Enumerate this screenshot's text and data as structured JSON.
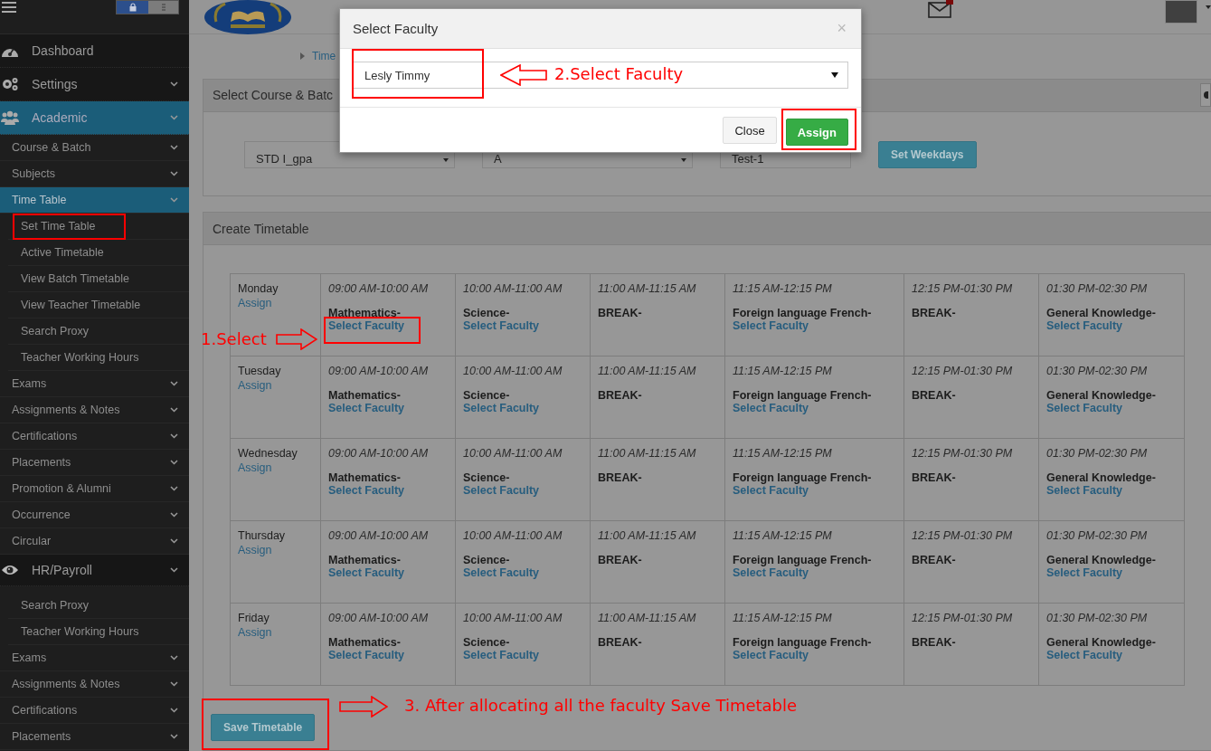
{
  "sidebar": {
    "items": [
      {
        "label": "Dashboard",
        "kind": "link",
        "selected": false
      },
      {
        "label": "Settings",
        "kind": "menu",
        "selected": false
      },
      {
        "label": "Academic",
        "kind": "menu",
        "selected": true,
        "children": [
          {
            "label": "Course & Batch",
            "kind": "menu",
            "selected": false
          },
          {
            "label": "Subjects",
            "kind": "menu",
            "selected": false
          },
          {
            "label": "Time Table",
            "kind": "menu",
            "selected": true,
            "children": [
              {
                "label": "Set Time Table",
                "kind": "link",
                "selected": false,
                "marked": true
              },
              {
                "label": "Active Timetable",
                "kind": "link",
                "selected": false,
                "marked": false
              },
              {
                "label": "View Batch Timetable",
                "kind": "link",
                "selected": false,
                "marked": false
              },
              {
                "label": "View Teacher Timetable",
                "kind": "link",
                "selected": false,
                "marked": false
              },
              {
                "label": "Search Proxy",
                "kind": "link",
                "selected": false,
                "marked": false
              },
              {
                "label": "Teacher Working Hours",
                "kind": "link",
                "selected": false,
                "marked": false
              }
            ]
          },
          {
            "label": "Exams",
            "kind": "menu",
            "selected": false
          },
          {
            "label": "Assignments & Notes",
            "kind": "menu",
            "selected": false
          },
          {
            "label": "Certifications",
            "kind": "menu",
            "selected": false
          },
          {
            "label": "Placements",
            "kind": "menu",
            "selected": false
          },
          {
            "label": "Promotion & Alumni",
            "kind": "menu",
            "selected": false
          },
          {
            "label": "Occurrence",
            "kind": "menu",
            "selected": false
          },
          {
            "label": "Circular",
            "kind": "menu",
            "selected": false
          }
        ]
      },
      {
        "label": "HR/Payroll",
        "kind": "menu",
        "selected": false,
        "children": [
          {
            "label": "Search Proxy",
            "kind": "link",
            "selected": false
          },
          {
            "label": "Teacher Working Hours",
            "kind": "link",
            "selected": false
          },
          {
            "label": "Exams",
            "kind": "menu",
            "selected": false
          },
          {
            "label": "Assignments & Notes",
            "kind": "menu",
            "selected": false
          },
          {
            "label": "Certifications",
            "kind": "menu",
            "selected": false
          },
          {
            "label": "Placements",
            "kind": "menu",
            "selected": false
          }
        ]
      }
    ]
  },
  "breadcrumb": "Time",
  "course_panel": {
    "title": "Select Course & Batc",
    "course": "STD I_gpa",
    "batch": "A",
    "test": "Test-1",
    "button": "Set Weekdays"
  },
  "timetable_panel": {
    "title": "Create Timetable",
    "save_button": "Save Timetable",
    "save_marked": true,
    "rows": [
      {
        "day": "Monday",
        "assign": "Assign",
        "slots": [
          {
            "time": "09:00 AM-10:00 AM",
            "subject": "Mathematics-",
            "link": "Select Faculty",
            "marked": true
          },
          {
            "time": "10:00 AM-11:00 AM",
            "subject": "Science-",
            "link": "Select Faculty",
            "marked": false
          },
          {
            "time": "11:00 AM-11:15 AM",
            "subject": "BREAK-",
            "marked": false
          },
          {
            "time": "11:15 AM-12:15 PM",
            "subject": "Foreign language French-",
            "link": "Select Faculty",
            "marked": false
          },
          {
            "time": "12:15 PM-01:30 PM",
            "subject": "BREAK-",
            "marked": false
          },
          {
            "time": "01:30 PM-02:30 PM",
            "subject": "General Knowledge-",
            "link": "Select Faculty",
            "marked": false
          }
        ]
      },
      {
        "day": "Tuesday",
        "assign": "Assign",
        "slots": [
          {
            "time": "09:00 AM-10:00 AM",
            "subject": "Mathematics-",
            "link": "Select Faculty",
            "marked": false
          },
          {
            "time": "10:00 AM-11:00 AM",
            "subject": "Science-",
            "link": "Select Faculty",
            "marked": false
          },
          {
            "time": "11:00 AM-11:15 AM",
            "subject": "BREAK-",
            "marked": false
          },
          {
            "time": "11:15 AM-12:15 PM",
            "subject": "Foreign language French-",
            "link": "Select Faculty",
            "marked": false
          },
          {
            "time": "12:15 PM-01:30 PM",
            "subject": "BREAK-",
            "marked": false
          },
          {
            "time": "01:30 PM-02:30 PM",
            "subject": "General Knowledge-",
            "link": "Select Faculty",
            "marked": false
          }
        ]
      },
      {
        "day": "Wednesday",
        "assign": "Assign",
        "slots": [
          {
            "time": "09:00 AM-10:00 AM",
            "subject": "Mathematics-",
            "link": "Select Faculty",
            "marked": false
          },
          {
            "time": "10:00 AM-11:00 AM",
            "subject": "Science-",
            "link": "Select Faculty",
            "marked": false
          },
          {
            "time": "11:00 AM-11:15 AM",
            "subject": "BREAK-",
            "marked": false
          },
          {
            "time": "11:15 AM-12:15 PM",
            "subject": "Foreign language French-",
            "link": "Select Faculty",
            "marked": false
          },
          {
            "time": "12:15 PM-01:30 PM",
            "subject": "BREAK-",
            "marked": false
          },
          {
            "time": "01:30 PM-02:30 PM",
            "subject": "General Knowledge-",
            "link": "Select Faculty",
            "marked": false
          }
        ]
      },
      {
        "day": "Thursday",
        "assign": "Assign",
        "slots": [
          {
            "time": "09:00 AM-10:00 AM",
            "subject": "Mathematics-",
            "link": "Select Faculty",
            "marked": false
          },
          {
            "time": "10:00 AM-11:00 AM",
            "subject": "Science-",
            "link": "Select Faculty",
            "marked": false
          },
          {
            "time": "11:00 AM-11:15 AM",
            "subject": "BREAK-",
            "marked": false
          },
          {
            "time": "11:15 AM-12:15 PM",
            "subject": "Foreign language French-",
            "link": "Select Faculty",
            "marked": false
          },
          {
            "time": "12:15 PM-01:30 PM",
            "subject": "BREAK-",
            "marked": false
          },
          {
            "time": "01:30 PM-02:30 PM",
            "subject": "General Knowledge-",
            "link": "Select Faculty",
            "marked": false
          }
        ]
      },
      {
        "day": "Friday",
        "assign": "Assign",
        "slots": [
          {
            "time": "09:00 AM-10:00 AM",
            "subject": "Mathematics-",
            "link": "Select Faculty",
            "marked": false
          },
          {
            "time": "10:00 AM-11:00 AM",
            "subject": "Science-",
            "link": "Select Faculty",
            "marked": false
          },
          {
            "time": "11:00 AM-11:15 AM",
            "subject": "BREAK-",
            "marked": false
          },
          {
            "time": "11:15 AM-12:15 PM",
            "subject": "Foreign language French-",
            "link": "Select Faculty",
            "marked": false
          },
          {
            "time": "12:15 PM-01:30 PM",
            "subject": "BREAK-",
            "marked": false
          },
          {
            "time": "01:30 PM-02:30 PM",
            "subject": "General Knowledge-",
            "link": "Select Faculty",
            "marked": false
          }
        ]
      }
    ]
  },
  "dialog": {
    "title": "Select Faculty",
    "close_icon": "×",
    "select": {
      "value": "Lesly Timmy",
      "marked": true
    },
    "close_button": "Close",
    "assign_button": "Assign",
    "assign_marked": true
  },
  "annotations": [
    {
      "text": "1.Select"
    },
    {
      "text": "2.Select Faculty"
    },
    {
      "text": "3. After allocating all the faculty Save Timetable"
    }
  ]
}
